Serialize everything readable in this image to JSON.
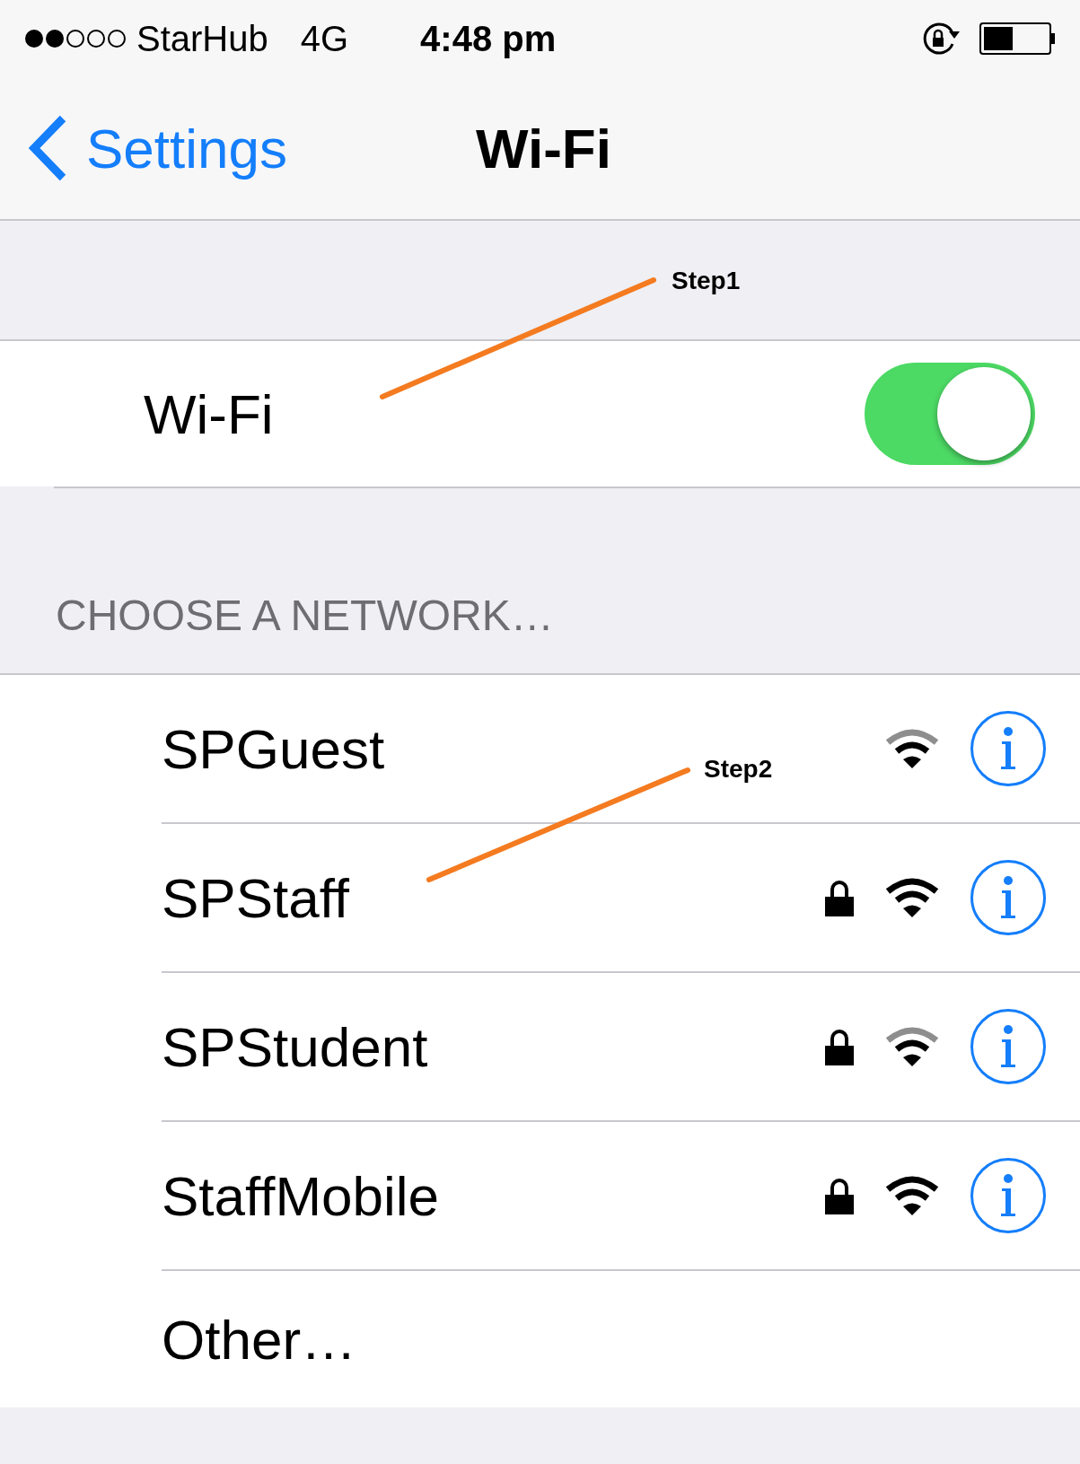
{
  "status_bar": {
    "carrier": "StarHub",
    "network": "4G",
    "time": "4:48 pm",
    "battery": {
      "level": 0.45
    }
  },
  "nav": {
    "back": "Settings",
    "title": "Wi-Fi"
  },
  "wifi_row": {
    "label": "Wi-Fi",
    "on": true
  },
  "section_header": "CHOOSE A NETWORK…",
  "networks": [
    {
      "name": "SPGuest",
      "locked": false,
      "kind": "weak"
    },
    {
      "name": "SPStaff",
      "locked": true,
      "kind": "full"
    },
    {
      "name": "SPStudent",
      "locked": true,
      "kind": "weak"
    },
    {
      "name": "StaffMobile",
      "locked": true,
      "kind": "full"
    }
  ],
  "other": "Other…",
  "annotations": [
    {
      "label": "Step1"
    },
    {
      "label": "Step2"
    }
  ]
}
